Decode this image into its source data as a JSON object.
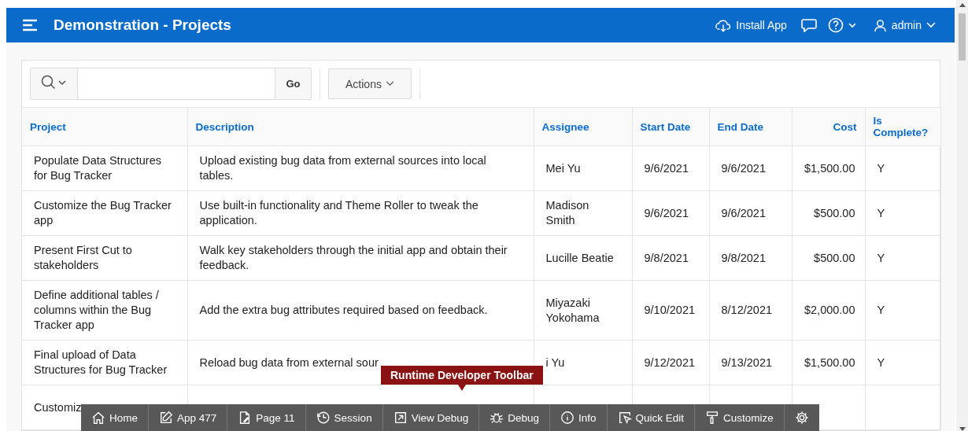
{
  "header": {
    "title": "Demonstration - Projects",
    "install_label": "Install App",
    "user": "admin"
  },
  "search": {
    "go_label": "Go",
    "actions_label": "Actions"
  },
  "table": {
    "columns": [
      {
        "label": "Project",
        "kind": "text"
      },
      {
        "label": "Description",
        "kind": "text"
      },
      {
        "label": "Assignee",
        "kind": "text"
      },
      {
        "label": "Start Date",
        "kind": "text"
      },
      {
        "label": "End Date",
        "kind": "text"
      },
      {
        "label": "Cost",
        "kind": "amount"
      },
      {
        "label": "Is Complete?",
        "kind": "text"
      }
    ],
    "rows": [
      {
        "cells": [
          "Populate Data Structures for Bug Tracker",
          "Upload existing bug data from external sources into local tables.",
          "Mei Yu",
          "9/6/2021",
          "9/6/2021",
          "$1,500.00",
          "Y"
        ]
      },
      {
        "cells": [
          "Customize the Bug Tracker app",
          "Use built-in functionality and Theme Roller to tweak the application.",
          "Madison Smith",
          "9/6/2021",
          "9/6/2021",
          "$500.00",
          "Y"
        ]
      },
      {
        "cells": [
          "Present First Cut to stakeholders",
          "Walk key stakeholders through the initial app and obtain their feedback.",
          "Lucille Beatie",
          "9/8/2021",
          "9/8/2021",
          "$500.00",
          "Y"
        ]
      },
      {
        "cells": [
          "Define additional tables / columns within the Bug Tracker app",
          "Add the extra bug attributes required based on feedback.",
          "Miyazaki Yokohama",
          "9/10/2021",
          "8/12/2021",
          "$2,000.00",
          "Y"
        ]
      },
      {
        "cells": [
          "Final upload of Data Structures for Bug Tracker",
          "Reload bug data from external sour",
          "i Yu",
          "9/12/2021",
          "9/13/2021",
          "$1,500.00",
          "Y"
        ]
      },
      {
        "cells": [
          "Customiz",
          "",
          "",
          "",
          "",
          "",
          ""
        ]
      }
    ]
  },
  "dev_toolbar": {
    "tooltip": "Runtime Developer Toolbar",
    "items": [
      {
        "label": "Home"
      },
      {
        "label": "App 477"
      },
      {
        "label": "Page 11"
      },
      {
        "label": "Session"
      },
      {
        "label": "View Debug"
      },
      {
        "label": "Debug"
      },
      {
        "label": "Info"
      },
      {
        "label": "Quick Edit"
      },
      {
        "label": "Customize"
      },
      {
        "kind": "settings"
      }
    ]
  }
}
